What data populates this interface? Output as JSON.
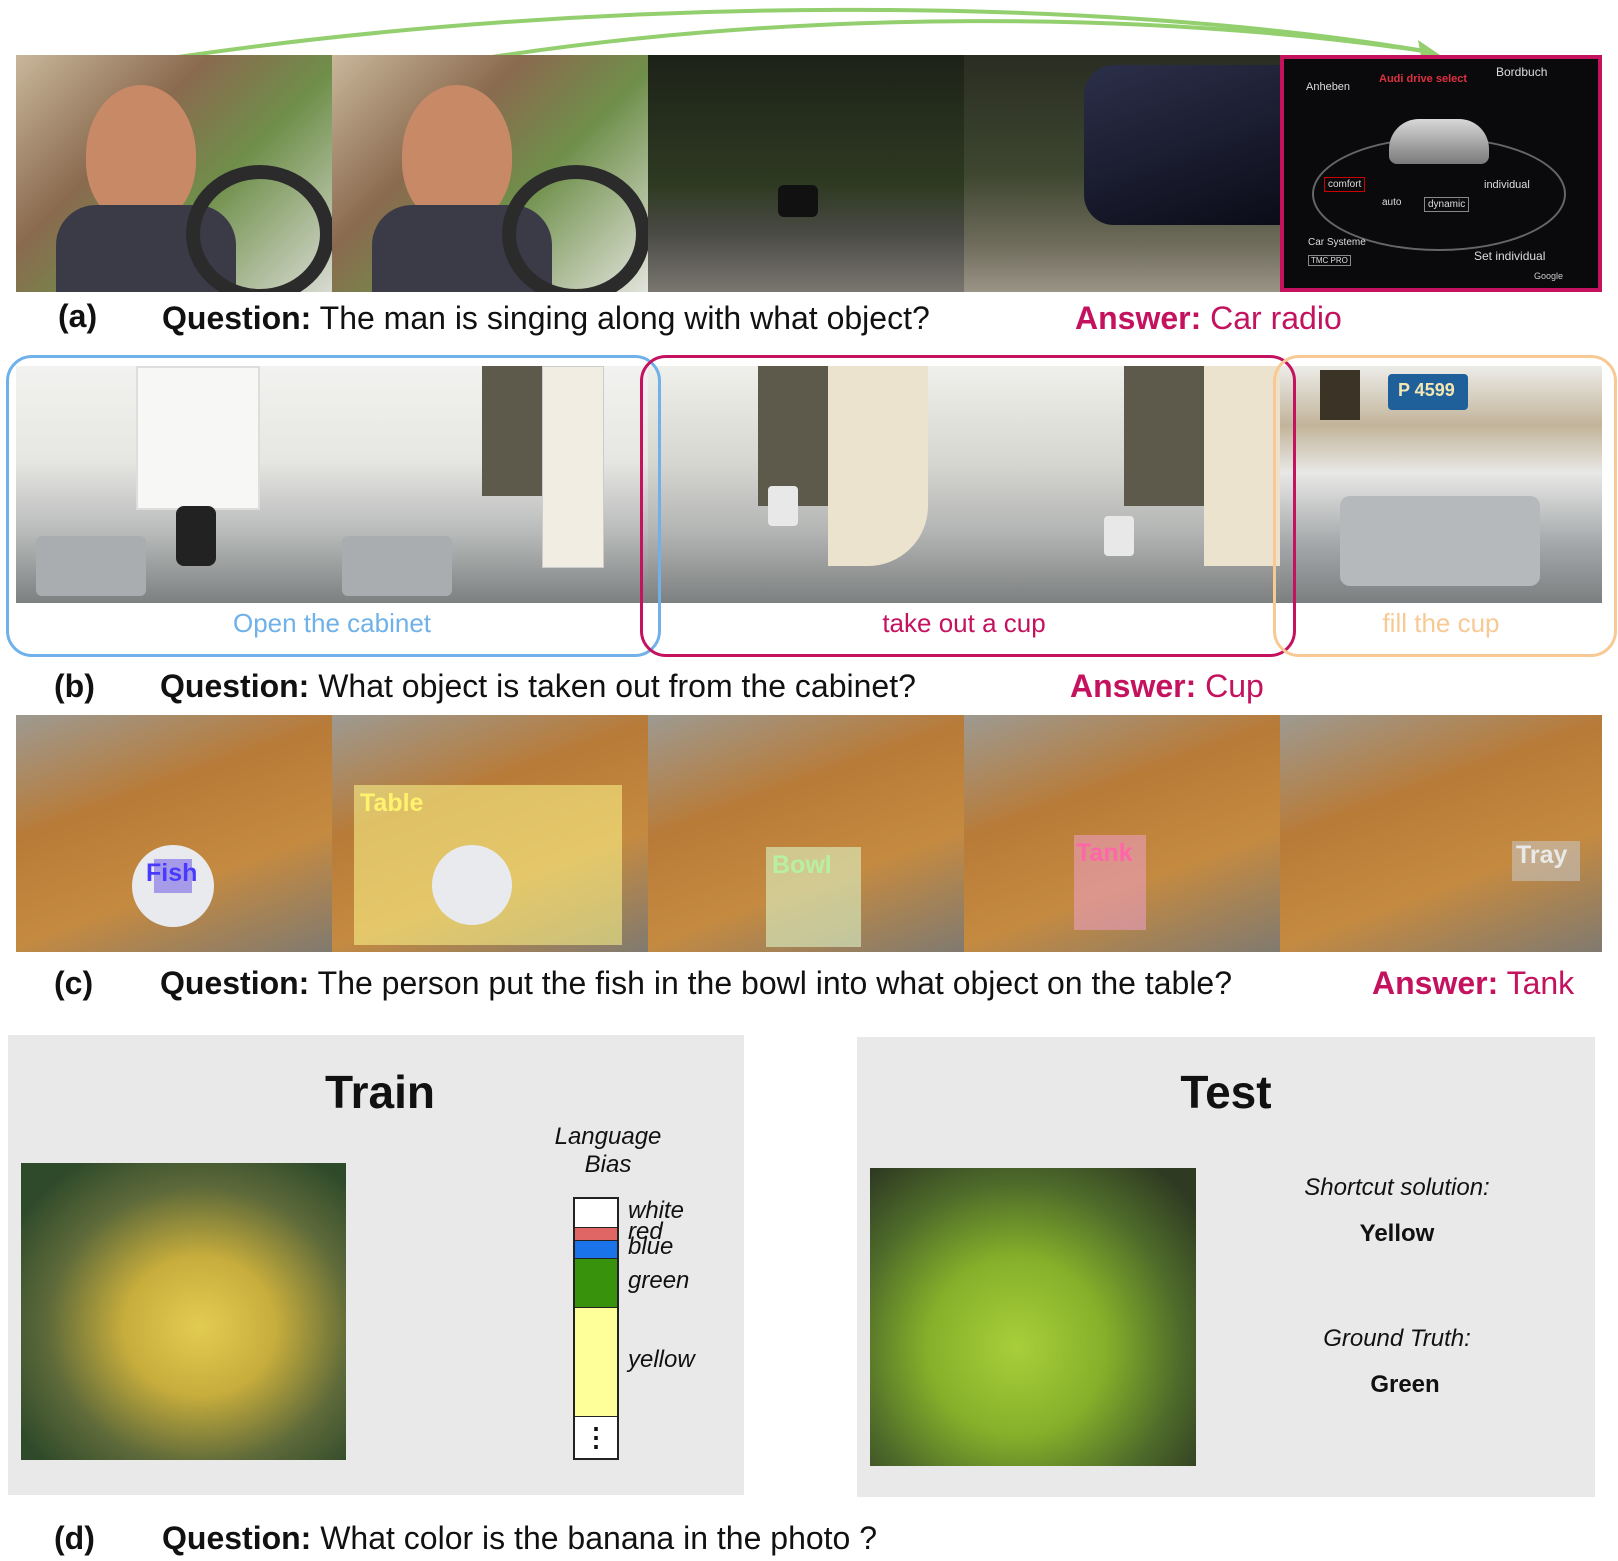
{
  "panel_a": {
    "label": "(a)",
    "question_key": "Question:",
    "question": "The man is singing along with what object?",
    "answer_key": "Answer:",
    "answer": "Car radio",
    "screen_texts": {
      "anheben": "Anheben",
      "drive_select": "Audi drive select",
      "bordbuch": "Bordbuch",
      "comfort": "comfort",
      "auto": "auto",
      "dynamic": "dynamic",
      "individual": "individual",
      "car_systeme": "Car Systeme",
      "set_individual": "Set individual",
      "tmc": "TMC PRO",
      "google": "Google"
    }
  },
  "panel_b": {
    "label": "(b)",
    "question_key": "Question:",
    "question": "What object is taken out from the cabinet?",
    "answer_key": "Answer:",
    "answer": "Cup",
    "segments": [
      "Open the cabinet",
      "take out a cup",
      "fill the cup"
    ],
    "plate_text": "P 4599"
  },
  "panel_c": {
    "label": "(c)",
    "question_key": "Question:",
    "question": "The person put the fish in the bowl into what object on the table?",
    "answer_key": "Answer:",
    "answer": "Tank",
    "box_labels": [
      "Fish",
      "Table",
      "Bowl",
      "Tank",
      "Tray"
    ]
  },
  "panel_d": {
    "label": "(d)",
    "question_key": "Question:",
    "question": "What color is the banana in the photo ?",
    "train_title": "Train",
    "test_title": "Test",
    "bias_title_1": "Language",
    "bias_title_2": "Bias",
    "bias": [
      {
        "name": "white",
        "fraction": 0.11,
        "color": "#ffffff"
      },
      {
        "name": "red",
        "fraction": 0.05,
        "color": "#e06666"
      },
      {
        "name": "blue",
        "fraction": 0.07,
        "color": "#1a73e8"
      },
      {
        "name": "green",
        "fraction": 0.19,
        "color": "#38920c"
      },
      {
        "name": "yellow",
        "fraction": 0.42,
        "color": "#ffff99"
      },
      {
        "name": "⋮",
        "fraction": 0.16,
        "color": "#ffffff"
      }
    ],
    "shortcut_label": "Shortcut solution:",
    "shortcut_value": "Yellow",
    "gt_label": "Ground Truth:",
    "gt_value": "Green"
  },
  "colors": {
    "answer": "#c4125f",
    "seg_open": "#6fb1e8",
    "seg_take": "#c4125f",
    "seg_fill": "#f8c994",
    "arrow": "#93cf6e"
  }
}
